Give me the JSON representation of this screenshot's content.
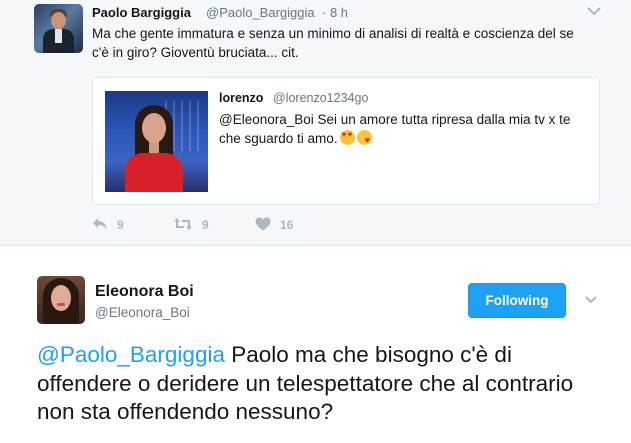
{
  "tweet1": {
    "author_name": "Paolo Bargiggia",
    "author_handle": "@Paolo_Bargiggia",
    "time": "· 8 h",
    "text": "Ma che gente immatura e senza un minimo di analisi di realtà e coscienza del se c'è in giro? Gioventù bruciata... cit.",
    "quoted": {
      "author_name": "lorenzo",
      "author_handle": "@lorenzo1234go",
      "text": "@Eleonora_Boi Sei un amore tutta ripresa dalla mia tv x te che sguardo ti amo.",
      "emojis": [
        "heart-eyes-emoji",
        "kiss-emoji"
      ]
    },
    "actions": {
      "replies": "9",
      "retweets": "9",
      "likes": "16"
    }
  },
  "tweet2": {
    "author_name": "Eleonora Boi",
    "author_handle": "@Eleonora_Boi",
    "follow_label": "Following",
    "mention": "@Paolo_Bargiggia",
    "text": " Paolo ma che bisogno c'è di offendere o deridere un telespettatore che al contrario non sta offendendo nessuno?"
  },
  "colors": {
    "accent": "#1da1f2",
    "muted": "#657786",
    "icon": "#aab8c2",
    "card_background": "#f5f8fa"
  }
}
